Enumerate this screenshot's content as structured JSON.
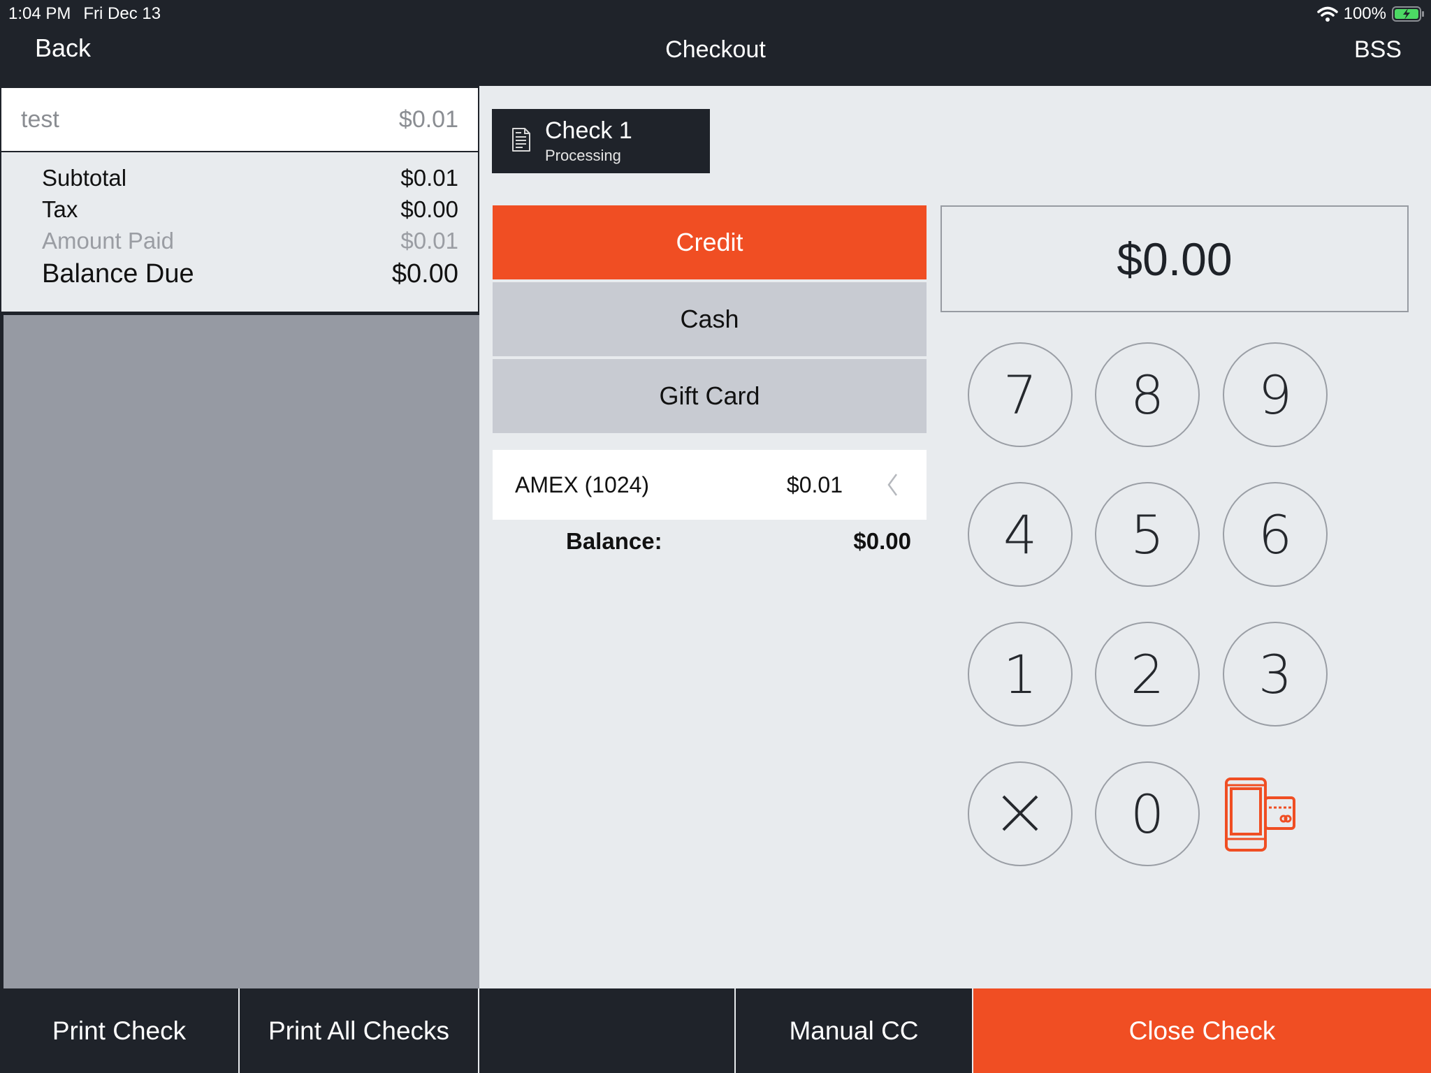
{
  "status_bar": {
    "time": "1:04 PM",
    "date": "Fri Dec 13",
    "battery": "100%",
    "icons": [
      "wifi-icon",
      "battery-charging-icon"
    ]
  },
  "header": {
    "back_label": "Back",
    "title": "Checkout",
    "user": "BSS"
  },
  "order": {
    "items": [
      {
        "name": "test",
        "price": "$0.01"
      }
    ],
    "summary": [
      {
        "label": "Subtotal",
        "value": "$0.01"
      },
      {
        "label": "Tax",
        "value": "$0.00"
      },
      {
        "label": "Amount Paid",
        "value": "$0.01"
      },
      {
        "label": "Balance Due",
        "value": "$0.00"
      }
    ]
  },
  "check_tab": {
    "icon": "document-icon",
    "name": "Check 1",
    "status": "Processing"
  },
  "payment_methods": [
    {
      "label": "Credit",
      "selected": true
    },
    {
      "label": "Cash",
      "selected": false
    },
    {
      "label": "Gift Card",
      "selected": false
    }
  ],
  "payments": [
    {
      "card": "AMEX (1024)",
      "amount": "$0.01",
      "icon": "chevron-left-icon"
    }
  ],
  "balance": {
    "label": "Balance:",
    "value": "$0.00"
  },
  "amount_display": "$0.00",
  "keypad": {
    "keys": [
      "7",
      "8",
      "9",
      "4",
      "5",
      "6",
      "1",
      "2",
      "3",
      "×",
      "0"
    ],
    "card_reader_icon": "card-reader-icon"
  },
  "bottom_bar": {
    "print_check": "Print Check",
    "print_all_checks": "Print All Checks",
    "manual_cc": "Manual CC",
    "close_check": "Close Check"
  },
  "colors": {
    "accent": "#f04e23",
    "dark": "#1f232a",
    "background": "#e8ebee",
    "button_gray": "#c8cbd2",
    "panel_gray": "#969aa3"
  }
}
